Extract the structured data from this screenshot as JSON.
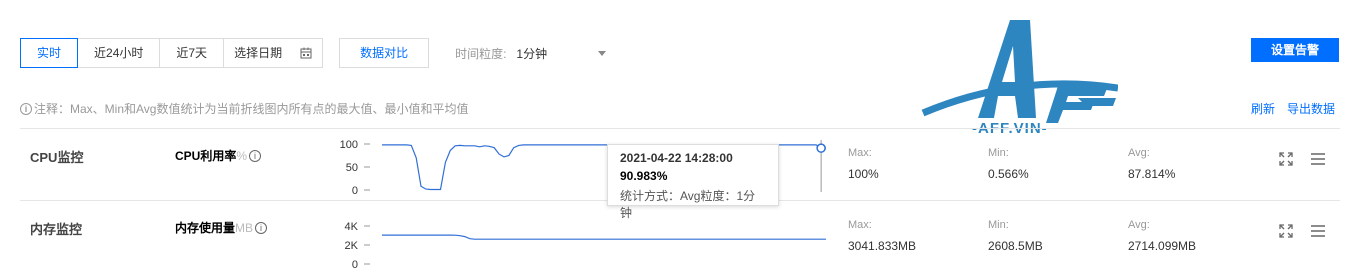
{
  "toolbar": {
    "ranges": [
      {
        "label": "实时",
        "active": true
      },
      {
        "label": "近24小时",
        "active": false
      },
      {
        "label": "近7天",
        "active": false
      }
    ],
    "date_label": "选择日期",
    "compare_label": "数据对比",
    "granularity_label": "时间粒度:",
    "granularity_value": "1分钟",
    "alarm_label": "设置告警"
  },
  "note": {
    "text": "注释：Max、Min和Avg数值统计为当前折线图内所有点的最大值、最小值和平均值"
  },
  "links": {
    "refresh": "刷新",
    "export": "导出数据"
  },
  "watermark": {
    "text": "-AFF.VIN-"
  },
  "rows": [
    {
      "title": "CPU监控",
      "metric": "CPU利用率",
      "unit": "%",
      "yticks": [
        "100",
        "50",
        "0"
      ],
      "max_label": "Max:",
      "max": "100%",
      "min_label": "Min:",
      "min": "0.566%",
      "avg_label": "Avg:",
      "avg": "87.814%"
    },
    {
      "title": "内存监控",
      "metric": "内存使用量",
      "unit": "MB",
      "yticks": [
        "4K",
        "2K",
        "0"
      ],
      "max_label": "Max:",
      "max": "3041.833MB",
      "min_label": "Min:",
      "min": "2608.5MB",
      "avg_label": "Avg:",
      "avg": "2714.099MB"
    }
  ],
  "tooltip": {
    "time": "2021-04-22 14:28:00",
    "value": "90.983%",
    "method": "统计方式：Avg粒度：1分钟"
  },
  "chart_data": [
    {
      "type": "line",
      "ylabel": "",
      "ylim": [
        0,
        100
      ],
      "series": [
        {
          "values": [
            98,
            98,
            98,
            98,
            98,
            98,
            97,
            70,
            8,
            2,
            1,
            1,
            1,
            60,
            86,
            96,
            97,
            96,
            96,
            96,
            94,
            96,
            95,
            92,
            78,
            72,
            75,
            92,
            97,
            98,
            98,
            98,
            98,
            98,
            98,
            98,
            98,
            98,
            98,
            98,
            98,
            98,
            98,
            98,
            98,
            98,
            98,
            98,
            98,
            98,
            98,
            98,
            98,
            98,
            98,
            98,
            98,
            98,
            98,
            98,
            98,
            98,
            98,
            98,
            98,
            98,
            98,
            98,
            98,
            98,
            98,
            98,
            98,
            98,
            98,
            98,
            98,
            98,
            98,
            98,
            98,
            98,
            98,
            98,
            98,
            98,
            98,
            98,
            98,
            98,
            91,
            91
          ]
        }
      ]
    },
    {
      "type": "line",
      "ylabel": "",
      "ylim": [
        0,
        4000
      ],
      "series": [
        {
          "values": [
            3040,
            3040,
            3040,
            3040,
            3040,
            3040,
            3040,
            3040,
            3040,
            3040,
            3040,
            3040,
            3040,
            3040,
            3040,
            3030,
            2980,
            2880,
            2660,
            2610,
            2610,
            2610,
            2610,
            2610,
            2610,
            2610,
            2610,
            2610,
            2610,
            2610,
            2610,
            2610,
            2610,
            2610,
            2610,
            2610,
            2610,
            2610,
            2610,
            2610,
            2610,
            2610,
            2610,
            2610,
            2610,
            2610,
            2610,
            2610,
            2610,
            2610,
            2610,
            2610,
            2610,
            2610,
            2610,
            2610,
            2610,
            2610,
            2610,
            2610,
            2610,
            2610,
            2610,
            2610,
            2610,
            2610,
            2610,
            2610,
            2610,
            2610,
            2610,
            2610,
            2610,
            2610,
            2610,
            2610,
            2610,
            2610,
            2610,
            2610,
            2610,
            2610,
            2610,
            2610,
            2610,
            2610,
            2610,
            2610,
            2610,
            2610,
            2610,
            2610
          ]
        }
      ]
    }
  ]
}
